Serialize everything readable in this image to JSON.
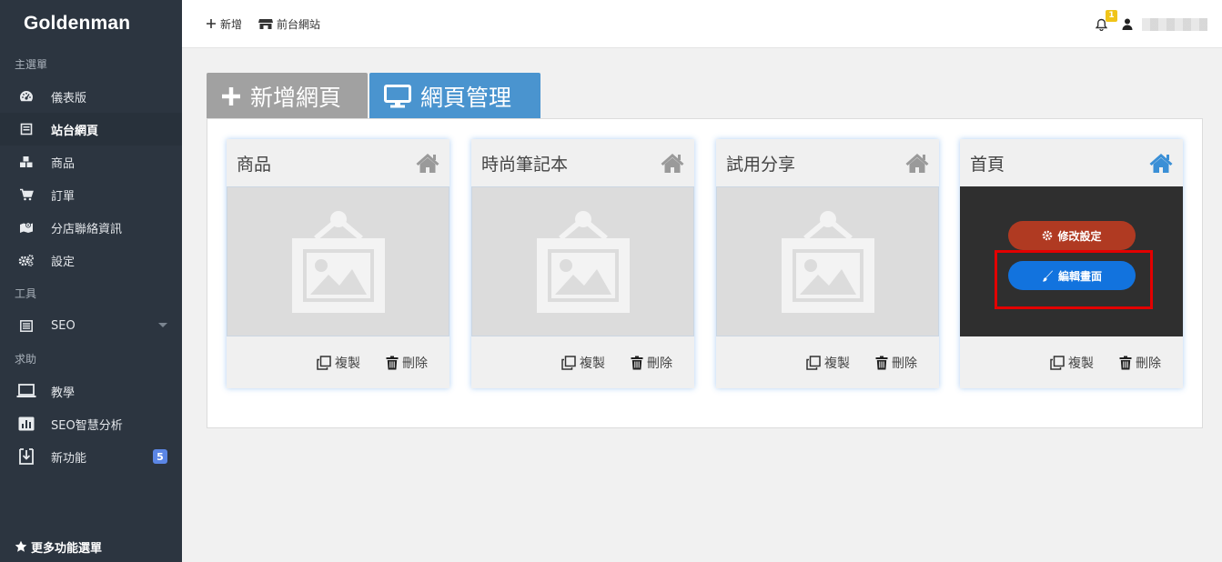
{
  "sidebar": {
    "brand": "Goldenman",
    "section_main": "主選單",
    "section_tools": "工具",
    "section_help": "求助",
    "items": [
      {
        "label": "儀表版",
        "icon": "dashboard-icon"
      },
      {
        "label": "站台網頁",
        "icon": "page-icon",
        "active": true
      },
      {
        "label": "商品",
        "icon": "cubes-icon"
      },
      {
        "label": "訂單",
        "icon": "cart-icon"
      },
      {
        "label": "分店聯絡資訊",
        "icon": "map-icon"
      },
      {
        "label": "設定",
        "icon": "gears-icon"
      }
    ],
    "tools_items": [
      {
        "label": "SEO",
        "icon": "list-icon"
      }
    ],
    "help_items": [
      {
        "label": "教學",
        "icon": "laptop-icon"
      },
      {
        "label": "SEO智慧分析",
        "icon": "bar-chart-icon"
      },
      {
        "label": "新功能",
        "icon": "download-icon",
        "badge": "5"
      }
    ],
    "footer": "更多功能選單"
  },
  "topbar": {
    "add_label": "新增",
    "storefront_label": "前台網站",
    "notification_count": "1"
  },
  "tabs": {
    "new_page": "新增網頁",
    "manage_pages": "網頁管理"
  },
  "cards": [
    {
      "title": "商品",
      "copy_label": "複製",
      "delete_label": "刪除",
      "home_color": "#9a9a9a"
    },
    {
      "title": "時尚筆記本",
      "copy_label": "複製",
      "delete_label": "刪除",
      "home_color": "#9a9a9a"
    },
    {
      "title": "試用分享",
      "copy_label": "複製",
      "delete_label": "刪除",
      "home_color": "#9a9a9a"
    },
    {
      "title": "首頁",
      "copy_label": "複製",
      "delete_label": "刪除",
      "home_color": "#3a8fd6",
      "settings_label": "修改設定",
      "edit_label": "編輯畫面"
    }
  ]
}
